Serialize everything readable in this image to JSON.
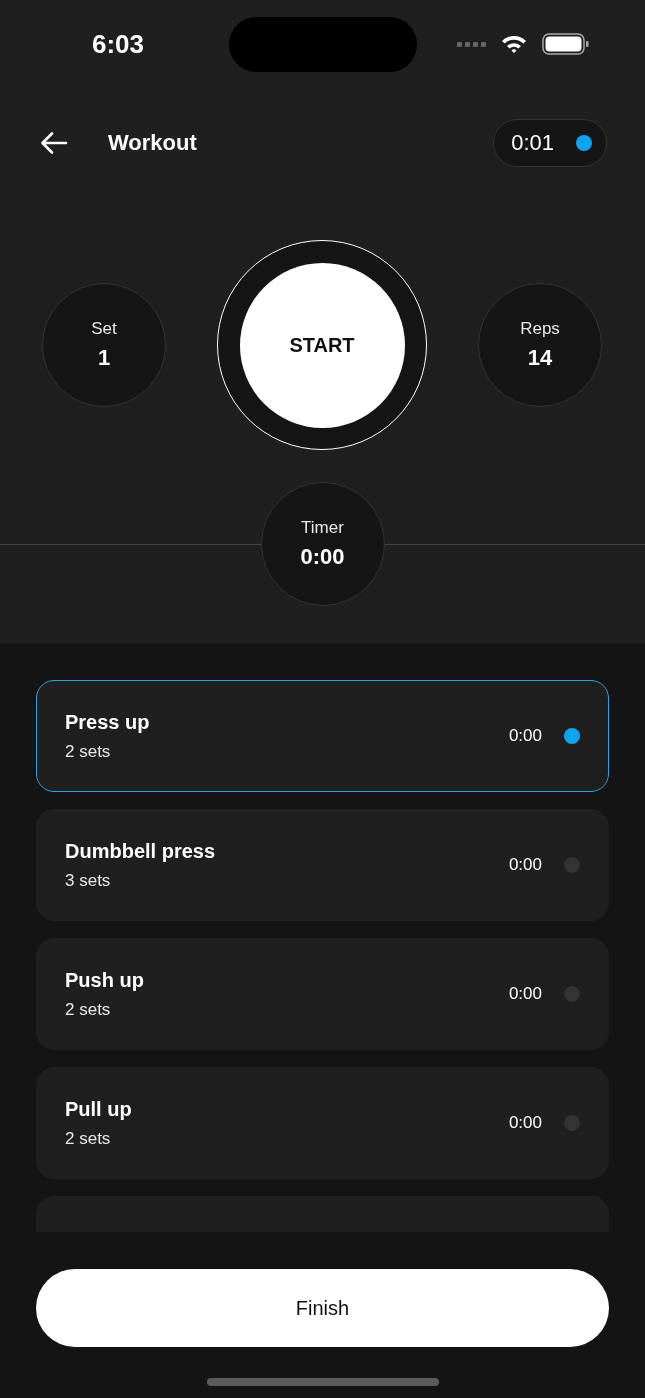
{
  "status_bar": {
    "time": "6:03"
  },
  "header": {
    "title": "Workout",
    "elapsed": "0:01"
  },
  "stats": {
    "set": {
      "label": "Set",
      "value": "1"
    },
    "start": {
      "label": "START"
    },
    "reps": {
      "label": "Reps",
      "value": "14"
    },
    "timer": {
      "label": "Timer",
      "value": "0:00"
    }
  },
  "exercises": [
    {
      "name": "Press up",
      "sets": "2 sets",
      "time": "0:00",
      "selected": true
    },
    {
      "name": "Dumbbell press",
      "sets": "3 sets",
      "time": "0:00",
      "selected": false
    },
    {
      "name": "Push up",
      "sets": "2 sets",
      "time": "0:00",
      "selected": false
    },
    {
      "name": "Pull up",
      "sets": "2 sets",
      "time": "0:00",
      "selected": false
    }
  ],
  "list": {
    "clipped_card_below": true
  },
  "finish_button": {
    "label": "Finish"
  }
}
